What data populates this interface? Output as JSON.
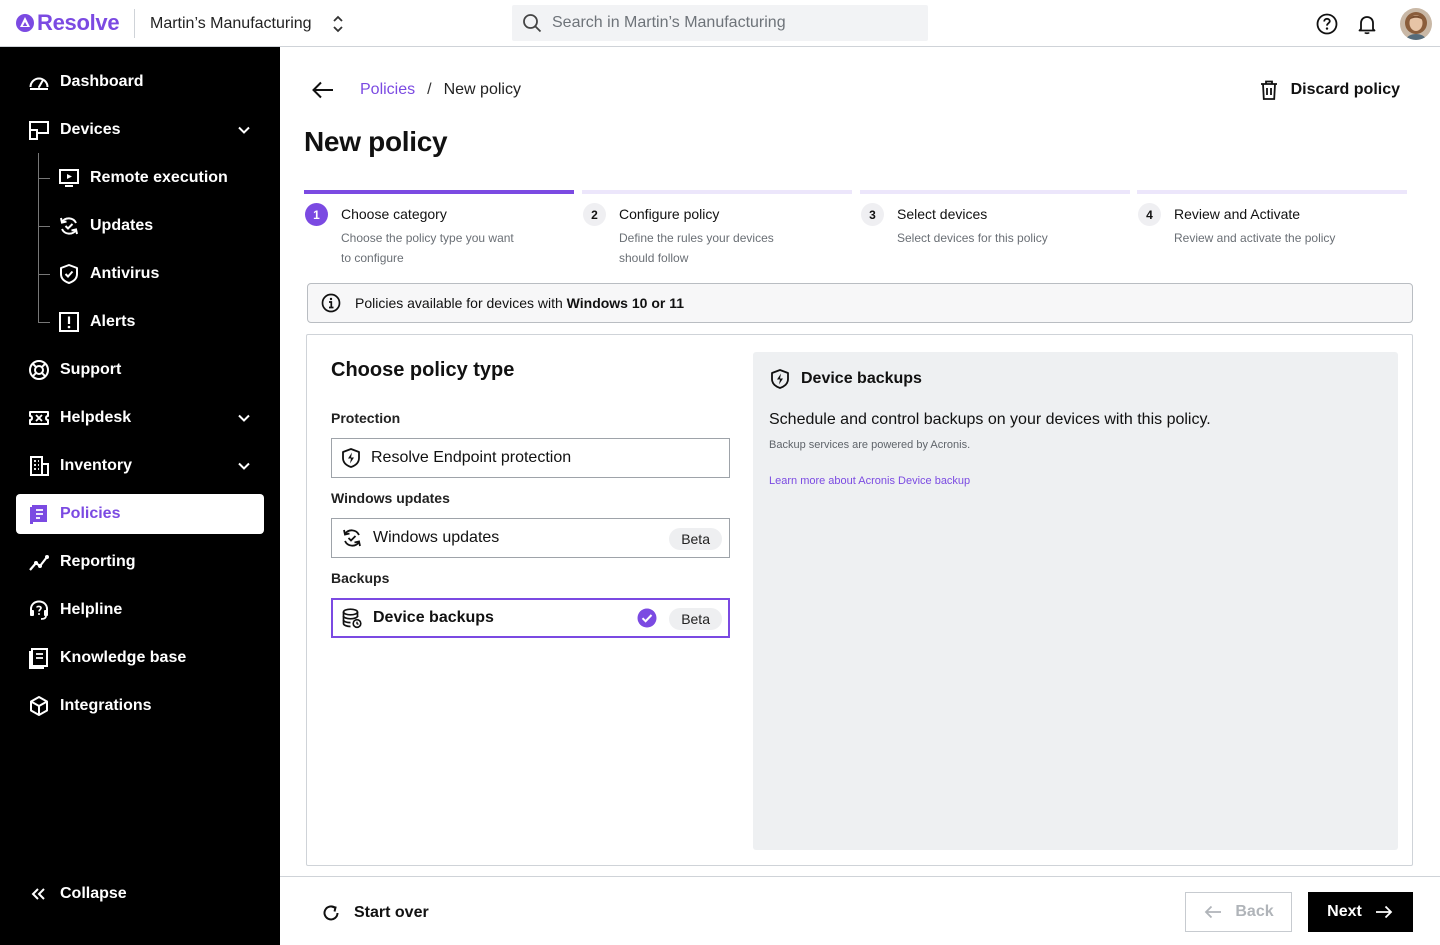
{
  "app": {
    "brand": "Resolve",
    "organization": "Martin’s Manufacturing",
    "search_placeholder": "Search in Martin’s Manufacturing",
    "accent_color": "#7b4ae2"
  },
  "sidebar": {
    "items": [
      {
        "label": "Dashboard",
        "icon": "gauge-icon"
      },
      {
        "label": "Devices",
        "icon": "devices-icon",
        "expandable": true,
        "expanded": true
      },
      {
        "label": "Support",
        "icon": "lifebuoy-icon"
      },
      {
        "label": "Helpdesk",
        "icon": "ticket-icon",
        "expandable": true
      },
      {
        "label": "Inventory",
        "icon": "building-icon",
        "expandable": true
      },
      {
        "label": "Policies",
        "icon": "policy-book-icon",
        "active": true
      },
      {
        "label": "Reporting",
        "icon": "chart-line-icon"
      },
      {
        "label": "Helpline",
        "icon": "headset-icon"
      },
      {
        "label": "Knowledge base",
        "icon": "book-icon"
      },
      {
        "label": "Integrations",
        "icon": "cube-icon"
      }
    ],
    "device_subitems": [
      {
        "label": "Remote execution",
        "icon": "monitor-play-icon"
      },
      {
        "label": "Updates",
        "icon": "refresh-check-icon"
      },
      {
        "label": "Antivirus",
        "icon": "shield-check-icon"
      },
      {
        "label": "Alerts",
        "icon": "alert-box-icon"
      }
    ],
    "collapse_label": "Collapse"
  },
  "breadcrumb": {
    "parent": "Policies",
    "separator": "/",
    "current": "New policy"
  },
  "header": {
    "title": "New policy",
    "discard_label": "Discard policy"
  },
  "steps": [
    {
      "number": "1",
      "title": "Choose category",
      "description": "Choose the policy type you want to configure",
      "active": true
    },
    {
      "number": "2",
      "title": "Configure policy",
      "description": "Define the rules your devices should follow"
    },
    {
      "number": "3",
      "title": "Select devices",
      "description": "Select devices for this policy"
    },
    {
      "number": "4",
      "title": "Review and Activate",
      "description": "Review and activate the policy"
    }
  ],
  "info": {
    "text": "Policies available for devices with ",
    "emphasis": "Windows 10 or 11"
  },
  "policy_picker": {
    "title": "Choose policy type",
    "groups": [
      {
        "label": "Protection",
        "option": {
          "label": "Resolve Endpoint protection",
          "icon": "shield-bolt-icon"
        }
      },
      {
        "label": "Windows updates",
        "option": {
          "label": "Windows updates",
          "icon": "refresh-check-icon",
          "badge": "Beta"
        }
      },
      {
        "label": "Backups",
        "option": {
          "label": "Device backups",
          "icon": "database-icon",
          "badge": "Beta",
          "selected": true
        }
      }
    ]
  },
  "detail": {
    "title": "Device backups",
    "icon": "shield-bolt-icon",
    "description": "Schedule and control backups on your devices with this policy.",
    "note": "Backup services are powered by Acronis.",
    "link": "Learn more about Acronis Device backup"
  },
  "footer": {
    "start_over_label": "Start over",
    "back_label": "Back",
    "next_label": "Next"
  }
}
